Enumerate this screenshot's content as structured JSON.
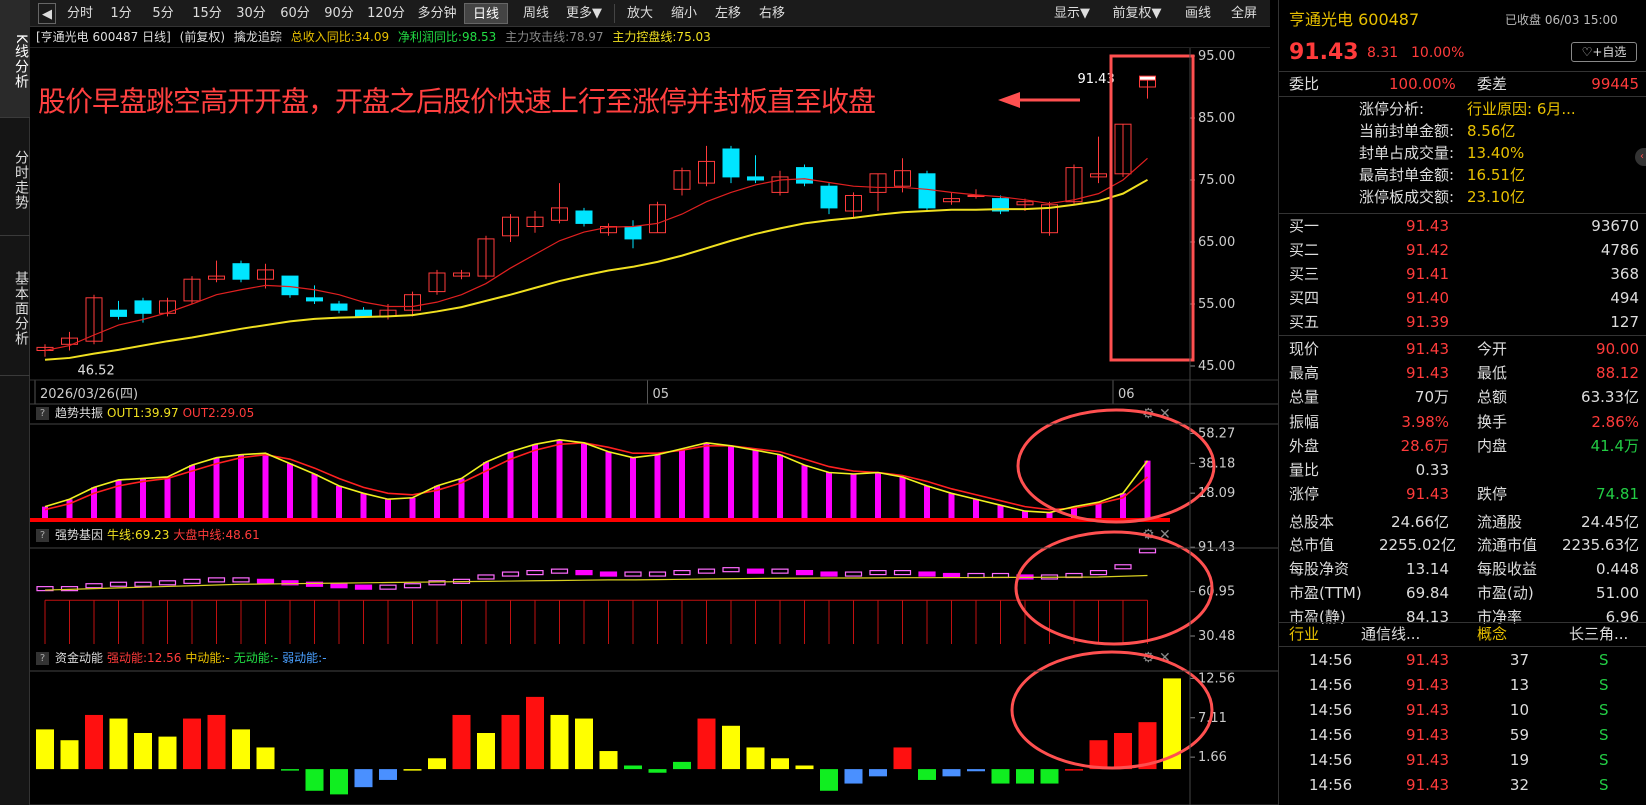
{
  "vtabs": [
    "K线分析",
    "分时走势",
    "基本面分析"
  ],
  "toolbar": {
    "back_icon": "back-arrow-icon",
    "periods": [
      "分时",
      "1分",
      "5分",
      "15分",
      "30分",
      "60分",
      "90分",
      "120分",
      "多分钟",
      "日线",
      "周线",
      "更多▼"
    ],
    "active_period": "日线",
    "tools": [
      "放大",
      "缩小",
      "左移",
      "右移"
    ],
    "right": [
      "显示▼",
      "前复权▼",
      "画线",
      "全屏"
    ]
  },
  "info": {
    "stock": "[亨通光电 600487 日线]",
    "adjust": "(前复权)",
    "indicator": "擒龙追踪",
    "revenue": "总收入同比:34.09",
    "profit": "净利润同比:98.53",
    "attack": "主力攻击线:78.97",
    "control": "主力控盘线:75.03"
  },
  "annotation": "股价早盘跳空高开开盘，开盘之后股价快速上行至涨停并封板直至收盘",
  "colors": {
    "up": "#ff3b3b",
    "down": "#00e5ff",
    "ma_red": "#e02020",
    "ma_yellow": "#f0e020",
    "magenta": "#ff00ff",
    "highlight": "#ff5050"
  },
  "chart_data": {
    "type": "candlestick",
    "y_axis": {
      "ticks": [
        "95.00",
        "85.00",
        "75.00",
        "65.00",
        "55.00",
        "45.00"
      ],
      "range": [
        45,
        95
      ]
    },
    "x_labels": [
      "2026/03/26(四)",
      "05",
      "06"
    ],
    "x_label_index": [
      0,
      25,
      44
    ],
    "low_label": "46.52",
    "last_label": "91.43",
    "ohlc": [
      [
        47.5,
        48.5,
        46.5,
        48.0
      ],
      [
        48.5,
        50.5,
        47.5,
        49.5
      ],
      [
        49.0,
        56.5,
        48.5,
        56.0
      ],
      [
        54.0,
        55.5,
        52.5,
        53.0
      ],
      [
        55.5,
        56.0,
        52.0,
        53.5
      ],
      [
        53.5,
        56.0,
        53.0,
        55.5
      ],
      [
        55.5,
        59.5,
        55.0,
        59.0
      ],
      [
        59.0,
        62.0,
        58.5,
        59.5
      ],
      [
        61.5,
        62.0,
        58.5,
        59.0
      ],
      [
        59.0,
        61.5,
        57.5,
        60.5
      ],
      [
        59.5,
        59.5,
        56.0,
        56.5
      ],
      [
        56.0,
        58.0,
        55.0,
        55.5
      ],
      [
        55.0,
        55.5,
        53.5,
        54.0
      ],
      [
        54.0,
        54.5,
        53.0,
        53.0
      ],
      [
        53.0,
        55.0,
        52.5,
        54.0
      ],
      [
        54.0,
        57.0,
        53.0,
        56.5
      ],
      [
        57.0,
        60.5,
        56.5,
        60.0
      ],
      [
        59.5,
        60.5,
        59.0,
        60.0
      ],
      [
        59.5,
        66.0,
        59.0,
        65.5
      ],
      [
        66.0,
        69.5,
        65.0,
        69.0
      ],
      [
        67.5,
        70.0,
        66.5,
        69.0
      ],
      [
        68.5,
        74.5,
        68.0,
        70.5
      ],
      [
        70.0,
        70.5,
        67.5,
        68.0
      ],
      [
        66.5,
        68.0,
        66.0,
        67.5
      ],
      [
        67.5,
        68.5,
        64.0,
        65.5
      ],
      [
        66.5,
        71.5,
        66.5,
        71.0
      ],
      [
        73.5,
        77.0,
        72.5,
        76.5
      ],
      [
        74.5,
        80.5,
        74.0,
        78.0
      ],
      [
        80.0,
        80.5,
        74.5,
        75.5
      ],
      [
        75.5,
        79.0,
        74.5,
        75.0
      ],
      [
        73.0,
        76.5,
        72.5,
        75.5
      ],
      [
        77.0,
        77.5,
        74.0,
        74.5
      ],
      [
        74.0,
        74.5,
        69.5,
        70.5
      ],
      [
        70.0,
        73.0,
        69.0,
        72.5
      ],
      [
        73.0,
        76.0,
        70.0,
        76.0
      ],
      [
        74.0,
        78.5,
        73.0,
        76.5
      ],
      [
        76.0,
        76.5,
        70.0,
        70.5
      ],
      [
        71.5,
        73.0,
        71.0,
        72.0
      ],
      [
        72.5,
        73.5,
        72.0,
        72.5
      ],
      [
        72.0,
        72.5,
        69.5,
        70.0
      ],
      [
        71.0,
        72.0,
        70.0,
        71.5
      ],
      [
        66.5,
        71.5,
        66.0,
        71.0
      ],
      [
        71.5,
        77.5,
        71.0,
        77.0
      ],
      [
        75.5,
        82.0,
        74.5,
        76.0
      ],
      [
        76.0,
        84.0,
        75.5,
        84.0
      ],
      [
        90.0,
        91.43,
        88.12,
        91.43
      ]
    ],
    "ma_short": [
      47.5,
      48.3,
      50.0,
      51.6,
      52.5,
      53.6,
      55.0,
      56.5,
      57.3,
      58.0,
      57.8,
      57.3,
      56.5,
      55.3,
      54.6,
      54.6,
      55.3,
      56.5,
      58.3,
      60.8,
      63.0,
      65.2,
      66.6,
      67.4,
      67.5,
      68.0,
      69.5,
      71.5,
      73.0,
      74.2,
      75.0,
      75.2,
      74.6,
      74.0,
      73.8,
      73.8,
      73.5,
      73.0,
      72.6,
      72.3,
      71.8,
      71.2,
      71.8,
      72.8,
      75.0,
      78.5
    ],
    "ma_long": [
      46.0,
      46.3,
      47.0,
      47.6,
      48.3,
      49.0,
      49.6,
      50.3,
      51.0,
      51.6,
      52.2,
      52.6,
      52.8,
      52.9,
      53.0,
      53.2,
      53.8,
      54.5,
      55.5,
      56.5,
      57.6,
      58.7,
      59.6,
      60.4,
      61.0,
      61.8,
      62.8,
      64.0,
      65.2,
      66.3,
      67.2,
      68.0,
      68.5,
      68.9,
      69.4,
      69.8,
      70.0,
      70.2,
      70.2,
      70.3,
      70.3,
      70.5,
      71.0,
      71.6,
      72.8,
      75.03
    ],
    "panes": [
      {
        "title": "趋势共振",
        "labels": [
          "OUT1:39.97",
          "OUT2:29.05"
        ],
        "y_ticks": [
          "58.27",
          "38.18",
          "18.09"
        ],
        "range": [
          0,
          62
        ],
        "bars": [
          9,
          14,
          22,
          27,
          28,
          29,
          37,
          42,
          44,
          45,
          38,
          31,
          23,
          18,
          14,
          15,
          23,
          28,
          39,
          46,
          51,
          54,
          52,
          46,
          42,
          44,
          48,
          52,
          50,
          47,
          44,
          37,
          32,
          31,
          32,
          29,
          23,
          18,
          14,
          10,
          6,
          5,
          9,
          12,
          18,
          40
        ],
        "line_out1": [
          9,
          14,
          22,
          27,
          28,
          29,
          37,
          42,
          44,
          45,
          38,
          31,
          23,
          18,
          14,
          15,
          23,
          28,
          39,
          46,
          51,
          54,
          52,
          46,
          42,
          44,
          48,
          52,
          50,
          47,
          44,
          37,
          32,
          31,
          32,
          29,
          23,
          18,
          14,
          10,
          6,
          5,
          9,
          12,
          18,
          39.97
        ],
        "line_out2": [
          7,
          11,
          18,
          23,
          26,
          28,
          33,
          38,
          42,
          44,
          41,
          35,
          28,
          22,
          18,
          17,
          20,
          25,
          33,
          41,
          47,
          51,
          52,
          49,
          45,
          45,
          47,
          50,
          50,
          48,
          46,
          41,
          36,
          33,
          32,
          30,
          26,
          21,
          17,
          13,
          9,
          7,
          8,
          11,
          15,
          29.05
        ]
      },
      {
        "title": "强势基因",
        "labels": [
          "牛线:69.23",
          "大盘中线:48.61"
        ],
        "y_ticks": [
          "91.43",
          "60.95",
          "30.48"
        ],
        "range": [
          25,
          95
        ],
        "boxes": [
          63,
          63,
          65,
          66,
          66,
          67,
          68,
          69,
          69,
          68,
          67,
          66,
          65,
          64,
          64,
          65,
          67,
          68,
          71,
          73,
          74,
          75,
          74,
          73,
          73,
          73,
          74,
          75,
          76,
          75,
          75,
          74,
          73,
          73,
          74,
          74,
          73,
          72,
          72,
          72,
          71,
          71,
          72,
          74,
          78,
          89
        ],
        "niu_line": [
          62,
          62.5,
          63,
          63.5,
          64,
          64.5,
          65,
          65.5,
          66,
          66.2,
          66.4,
          66.6,
          66.8,
          67,
          67.2,
          67.4,
          67.6,
          67.8,
          68,
          68.2,
          68.4,
          68.6,
          68.8,
          69,
          69,
          69.2,
          69.4,
          69.6,
          69.8,
          70,
          70.1,
          70.2,
          70.3,
          70.3,
          70.4,
          70.5,
          70.5,
          70.6,
          70.6,
          70.7,
          70.7,
          70.8,
          70.9,
          71,
          71.5,
          72
        ],
        "hist_top": 55
      },
      {
        "title": "资金动能",
        "labels": [
          "强动能:12.56",
          "中动能:-",
          "无动能:-",
          "弱动能:-"
        ],
        "y_ticks": [
          "12.56",
          "7.11",
          "1.66"
        ],
        "range": [
          -4,
          14
        ],
        "bars": [
          5.5,
          4,
          7.5,
          7,
          5,
          4.5,
          7,
          7.5,
          5.5,
          3,
          0,
          -3,
          -3.5,
          -2.5,
          -1.5,
          0,
          1.5,
          7.5,
          5,
          7.5,
          10,
          7.5,
          7,
          2.5,
          0.5,
          -0.5,
          1,
          7,
          6,
          3,
          1.5,
          0.5,
          -3,
          -2,
          -1,
          3,
          -1.5,
          -1,
          -0.3,
          -2,
          -2,
          -2,
          0,
          4,
          5,
          6.5,
          12.56
        ],
        "colors_of_bars": [
          "Y",
          "Y",
          "R",
          "Y",
          "Y",
          "Y",
          "R",
          "R",
          "Y",
          "Y",
          "G",
          "G",
          "G",
          "B",
          "B",
          "Y",
          "Y",
          "R",
          "Y",
          "R",
          "R",
          "Y",
          "Y",
          "Y",
          "G",
          "G",
          "G",
          "R",
          "Y",
          "Y",
          "Y",
          "Y",
          "G",
          "B",
          "B",
          "R",
          "G",
          "B",
          "B",
          "G",
          "G",
          "G",
          "R",
          "R",
          "R",
          "R"
        ]
      }
    ]
  },
  "quote": {
    "name": "亨通光电 600487",
    "status": "已收盘 06/03 15:00",
    "price": "91.43",
    "change": "8.31",
    "pct": "10.00%",
    "watch_btn": "+自选",
    "ratio_label": "委比",
    "ratio": "100.00%",
    "diff_label": "委差",
    "diff": "99445",
    "limit_lines": [
      [
        "涨停分析:",
        "行业原因: 6月..."
      ],
      [
        "当前封单金额:",
        "8.56亿"
      ],
      [
        "封单占成交量:",
        "13.40%"
      ],
      [
        "最高封单金额:",
        "16.51亿"
      ],
      [
        "涨停板成交额:",
        "23.10亿"
      ]
    ],
    "bids": [
      [
        "买一",
        "91.43",
        "93670"
      ],
      [
        "买二",
        "91.42",
        "4786"
      ],
      [
        "买三",
        "91.41",
        "368"
      ],
      [
        "买四",
        "91.40",
        "494"
      ],
      [
        "买五",
        "91.39",
        "127"
      ]
    ],
    "stats": [
      [
        "现价",
        "91.43",
        "今开",
        "90.00"
      ],
      [
        "最高",
        "91.43",
        "最低",
        "88.12"
      ],
      [
        "总量",
        "70万",
        "总额",
        "63.33亿"
      ],
      [
        "振幅",
        "3.98%",
        "换手",
        "2.86%"
      ],
      [
        "外盘",
        "28.6万",
        "内盘",
        "41.4万"
      ],
      [
        "量比",
        "0.33",
        "",
        ""
      ],
      [
        "涨停",
        "91.43",
        "跌停",
        "74.81"
      ],
      [
        "总股本",
        "24.66亿",
        "流通股",
        "24.45亿"
      ],
      [
        "总市值",
        "2255.02亿",
        "流通市值",
        "2235.63亿"
      ],
      [
        "每股净资",
        "13.14",
        "每股收益",
        "0.448"
      ],
      [
        "市盈(TTM)",
        "69.84",
        "市盈(动)",
        "51.00"
      ],
      [
        "市盈(静)",
        "84.13",
        "市净率",
        "6.96"
      ]
    ],
    "industry": [
      "行业",
      "通信线...",
      "概念",
      "长三角..."
    ],
    "ticks": [
      [
        "14:56",
        "91.43",
        "37",
        "S"
      ],
      [
        "14:56",
        "91.43",
        "13",
        "S"
      ],
      [
        "14:56",
        "91.43",
        "10",
        "S"
      ],
      [
        "14:56",
        "91.43",
        "59",
        "S"
      ],
      [
        "14:56",
        "91.43",
        "19",
        "S"
      ],
      [
        "14:56",
        "91.43",
        "32",
        "S"
      ]
    ]
  }
}
